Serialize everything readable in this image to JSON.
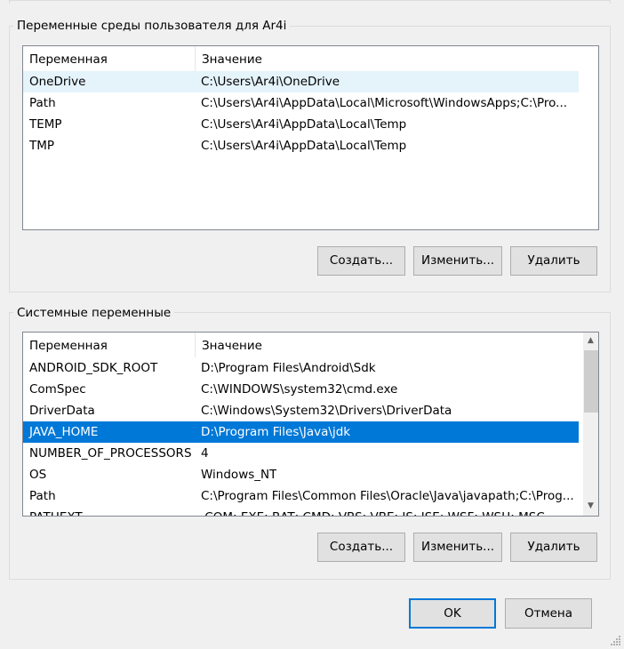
{
  "user_vars": {
    "group_label": "Переменные среды пользователя для Ar4i",
    "col_variable": "Переменная",
    "col_value": "Значение",
    "rows": [
      {
        "name": "OneDrive",
        "value": "C:\\Users\\Ar4i\\OneDrive"
      },
      {
        "name": "Path",
        "value": "C:\\Users\\Ar4i\\AppData\\Local\\Microsoft\\WindowsApps;C:\\Pro..."
      },
      {
        "name": "TEMP",
        "value": "C:\\Users\\Ar4i\\AppData\\Local\\Temp"
      },
      {
        "name": "TMP",
        "value": "C:\\Users\\Ar4i\\AppData\\Local\\Temp"
      }
    ],
    "buttons": {
      "new": "Создать...",
      "edit": "Изменить...",
      "delete": "Удалить"
    }
  },
  "system_vars": {
    "group_label": "Системные переменные",
    "col_variable": "Переменная",
    "col_value": "Значение",
    "rows": [
      {
        "name": "ANDROID_SDK_ROOT",
        "value": "D:\\Program Files\\Android\\Sdk"
      },
      {
        "name": "ComSpec",
        "value": "C:\\WINDOWS\\system32\\cmd.exe"
      },
      {
        "name": "DriverData",
        "value": "C:\\Windows\\System32\\Drivers\\DriverData"
      },
      {
        "name": "JAVA_HOME",
        "value": "D:\\Program Files\\Java\\jdk"
      },
      {
        "name": "NUMBER_OF_PROCESSORS",
        "value": "4"
      },
      {
        "name": "OS",
        "value": "Windows_NT"
      },
      {
        "name": "Path",
        "value": "C:\\Program Files\\Common Files\\Oracle\\Java\\javapath;C:\\Prog..."
      },
      {
        "name": "PATHEXT",
        "value": ".COM;.EXE;.BAT;.CMD;.VBS;.VBE;.JS;.JSE;.WSF;.WSH;.MSC"
      }
    ],
    "selected_row": "JAVA_HOME",
    "buttons": {
      "new": "Создать...",
      "edit": "Изменить...",
      "delete": "Удалить"
    }
  },
  "dialog_buttons": {
    "ok": "OK",
    "cancel": "Отмена"
  },
  "colors": {
    "selection": "#0078d7",
    "hover": "#e5f3fb",
    "focus_border": "#0078d7"
  }
}
